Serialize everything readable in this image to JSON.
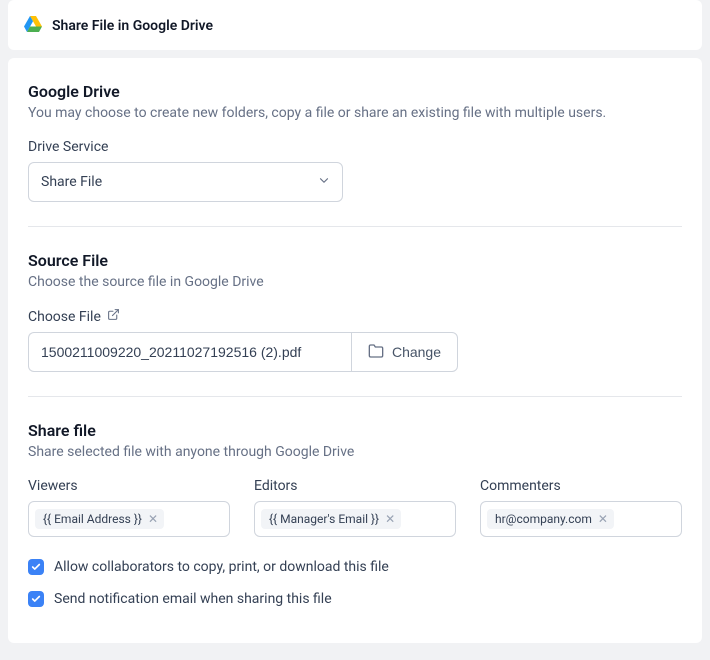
{
  "header": {
    "title": "Share File in Google Drive"
  },
  "drive": {
    "title": "Google Drive",
    "desc": "You may choose to create new folders, copy a file or share an existing file with multiple users.",
    "service_label": "Drive Service",
    "service_value": "Share File"
  },
  "source": {
    "title": "Source File",
    "desc": "Choose the source file in Google Drive",
    "choose_label": "Choose File",
    "file_value": "1500211009220_20211027192516 (2).pdf",
    "change_label": "Change"
  },
  "share": {
    "title": "Share file",
    "desc": "Share selected file with anyone through Google Drive",
    "viewers_label": "Viewers",
    "editors_label": "Editors",
    "commenters_label": "Commenters",
    "viewers_tag": "{{ Email Address }}",
    "editors_tag": "{{ Manager's Email }}",
    "commenters_tag": "hr@company.com",
    "allow_copy_label": "Allow collaborators to copy, print, or download this file",
    "send_email_label": "Send notification email when sharing this file"
  }
}
